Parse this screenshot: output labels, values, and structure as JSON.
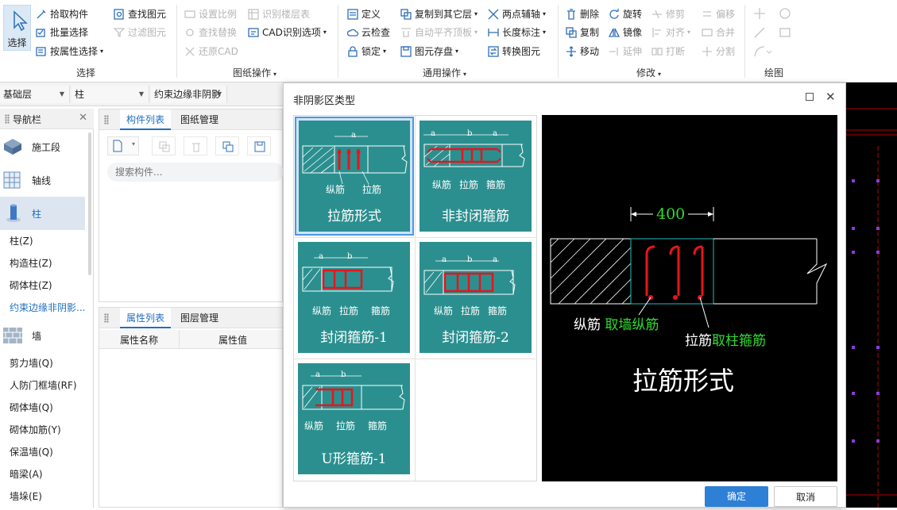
{
  "ribbon": {
    "select_group": {
      "big_button": "选择",
      "pick": "拾取构件",
      "batch": "批量选择",
      "by_attr": "按属性选择",
      "find": "查找图元",
      "filter": "过滤图元",
      "label": "选择"
    },
    "drawing_group": {
      "scale": "设置比例",
      "identify_layers": "识别楼层表",
      "find_replace": "查找替换",
      "cad_options": "CAD识别选项",
      "restore_cad": "还原CAD",
      "label": "图纸操作"
    },
    "common_group": {
      "define": "定义",
      "copy_to_layer": "复制到其它层",
      "two_point_axis": "两点辅轴",
      "cloud_check": "云检查",
      "auto_align": "自动平齐顶板",
      "length_mark": "长度标注",
      "lock": "锁定",
      "save_element": "图元存盘",
      "convert": "转换图元",
      "label": "通用操作"
    },
    "modify_group": {
      "delete": "删除",
      "rotate": "旋转",
      "trim": "修剪",
      "offset": "偏移",
      "copy": "复制",
      "mirror": "镜像",
      "align": "对齐",
      "merge": "合并",
      "move": "移动",
      "extend": "延伸",
      "break": "打断",
      "split": "分割",
      "label": "修改"
    },
    "draw_group": {
      "label": "绘图"
    }
  },
  "toolbar": {
    "floor": "基础层",
    "type": "柱",
    "component": "约束边缘非阴影"
  },
  "nav": {
    "title": "导航栏",
    "big_items": [
      "施工段",
      "轴线",
      "柱",
      "墙"
    ],
    "column_items": [
      "柱(Z)",
      "构造柱(Z)",
      "砌体柱(Z)",
      "约束边缘非阴影..."
    ],
    "wall_items": [
      "剪力墙(Q)",
      "人防门框墙(RF)",
      "砌体墙(Q)",
      "砌体加筋(Y)",
      "保温墙(Q)",
      "暗梁(A)",
      "墙垛(E)"
    ]
  },
  "component_panel": {
    "tab_list": "构件列表",
    "tab_drawings": "图纸管理",
    "search_placeholder": "搜索构件..."
  },
  "attr_panel": {
    "tab_list": "属性列表",
    "tab_layers": "图层管理",
    "col_name": "属性名称",
    "col_value": "属性值"
  },
  "dialog": {
    "title": "非阴影区类型",
    "options": [
      {
        "title": "拉筋形式",
        "labels": [
          "纵筋",
          "拉筋"
        ],
        "dims": [
          "a"
        ]
      },
      {
        "title": "非封闭箍筋",
        "labels": [
          "纵筋",
          "拉筋",
          "箍筋"
        ],
        "dims": [
          "a",
          "b",
          "a"
        ]
      },
      {
        "title": "封闭箍筋-1",
        "labels": [
          "纵筋",
          "拉筋",
          "箍筋"
        ],
        "dims": [
          "a",
          "b"
        ]
      },
      {
        "title": "封闭箍筋-2",
        "labels": [
          "纵筋",
          "拉筋",
          "箍筋"
        ],
        "dims": [
          "a",
          "b",
          "a"
        ]
      },
      {
        "title": "U形箍筋-1",
        "labels": [
          "纵筋",
          "拉筋",
          "箍筋"
        ],
        "dims": [
          "a",
          "b"
        ]
      }
    ],
    "selected_index": 0,
    "preview": {
      "dimension": "400",
      "label1_prefix": "纵筋 ",
      "label1_value": "取墙纵筋",
      "label2_prefix": "拉筋",
      "label2_value": "取柱箍筋",
      "title": "拉筋形式"
    },
    "ok": "确定",
    "cancel": "取消"
  },
  "colors": {
    "accent": "#1f6fc2",
    "card_bg": "#2b8f8f",
    "rebar_red": "#e8141b",
    "preview_green": "#2fdc2f",
    "ok_button": "#2e7fd6"
  }
}
